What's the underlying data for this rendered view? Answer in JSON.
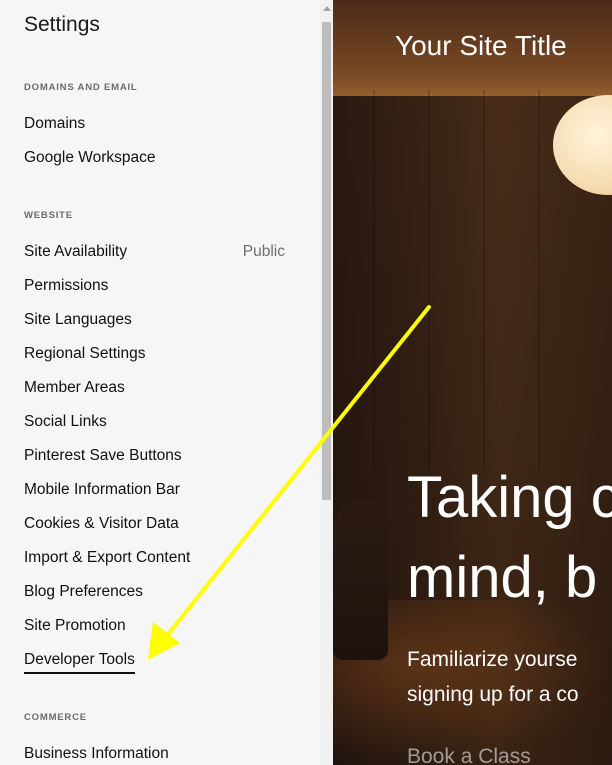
{
  "sidebar": {
    "title": "Settings",
    "sections": [
      {
        "header": "DOMAINS AND EMAIL",
        "items": [
          {
            "label": "Domains"
          },
          {
            "label": "Google Workspace"
          }
        ]
      },
      {
        "header": "WEBSITE",
        "items": [
          {
            "label": "Site Availability",
            "value": "Public"
          },
          {
            "label": "Permissions"
          },
          {
            "label": "Site Languages"
          },
          {
            "label": "Regional Settings"
          },
          {
            "label": "Member Areas"
          },
          {
            "label": "Social Links"
          },
          {
            "label": "Pinterest Save Buttons"
          },
          {
            "label": "Mobile Information Bar"
          },
          {
            "label": "Cookies & Visitor Data"
          },
          {
            "label": "Import & Export Content"
          },
          {
            "label": "Blog Preferences"
          },
          {
            "label": "Site Promotion"
          },
          {
            "label": "Developer Tools"
          }
        ]
      },
      {
        "header": "COMMERCE",
        "items": [
          {
            "label": "Business Information"
          }
        ]
      }
    ]
  },
  "preview": {
    "site_title": "Your Site Title",
    "hero_line1": "Taking c",
    "hero_line2": "mind, b",
    "sub_line1": "Familiarize yourse",
    "sub_line2": "signing up for a co",
    "cta_label": "Book a Class"
  },
  "annotation": {
    "color": "#ffff00",
    "target": "Developer Tools"
  }
}
